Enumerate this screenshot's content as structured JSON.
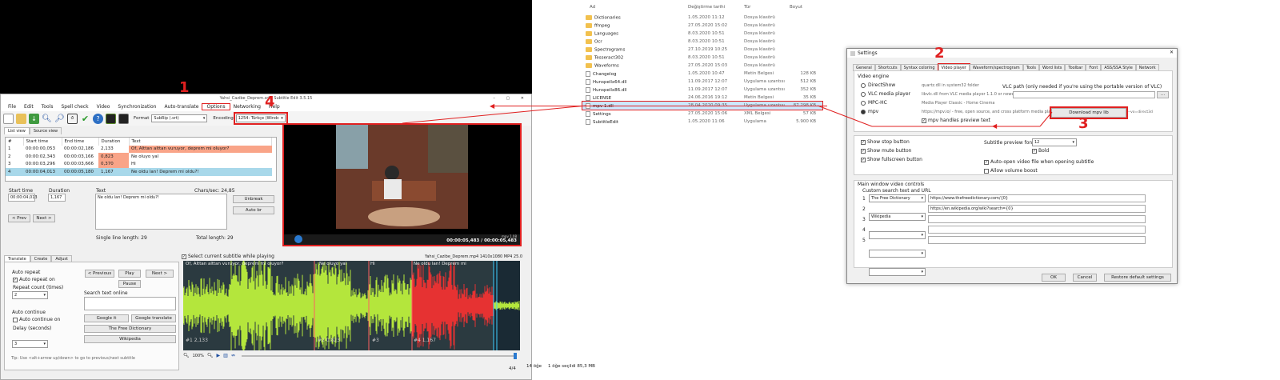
{
  "subtitle_edit": {
    "title": "Yahsi_Cazibe_Deprem.srt - Subtitle Edit 3.5.15",
    "window_controls": "–  ▢  ✕",
    "menu": [
      "File",
      "Edit",
      "Tools",
      "Spell check",
      "Video",
      "Synchronization",
      "Auto-translate",
      "Options",
      "Networking",
      "Help"
    ],
    "format_label": "Format",
    "format_value": "SubRip (.srt)",
    "encoding_label": "Encoding",
    "encoding_value": "1254: Türkçe (Windc",
    "tabs": [
      "List view",
      "Source view"
    ],
    "columns": [
      "#",
      "Start time",
      "End time",
      "Duration",
      "Text"
    ],
    "rows": [
      {
        "n": "1",
        "start": "00:00:00,053",
        "end": "00:00:02,186",
        "dur": "2,133",
        "text": "Of, Alttan alttan vuruyor, deprem mi oluyor?"
      },
      {
        "n": "2",
        "start": "00:00:02,343",
        "end": "00:00:03,166",
        "dur": "0,823",
        "text": "Ne oluyo yal"
      },
      {
        "n": "3",
        "start": "00:00:03,296",
        "end": "00:00:03,666",
        "dur": "0,370",
        "text": "Hi"
      },
      {
        "n": "4",
        "start": "00:00:04,013",
        "end": "00:00:05,180",
        "dur": "1,167",
        "text": "Ne oldu lan! Deprem mi oldu?!"
      }
    ],
    "edit": {
      "start_label": "Start time",
      "dur_label": "Duration",
      "text_label": "Text",
      "chars_sec": "Chars/sec: 24,85",
      "start_val": "00:00:04,013",
      "dur_val": "1,167",
      "text_val": "Ne oldu lan! Deprem mi oldu?!",
      "unbreak": "Unbreak",
      "autobr": "Auto br",
      "prev": "< Prev",
      "next": "Next >",
      "single_len": "Single line length: 29",
      "total_len": "Total length: 29"
    },
    "video": {
      "time": "00:00:05,483 / 00:00:05,483",
      "mpv_label": "mpv 1.08"
    },
    "translate": {
      "tabs": [
        "Translate",
        "Create",
        "Adjust"
      ],
      "auto_repeat": "Auto repeat",
      "auto_repeat_on": "Auto repeat on",
      "repeat_count": "Repeat count (times)",
      "repeat_val": "2",
      "auto_continue": "Auto continue",
      "auto_continue_on": "Auto continue on",
      "delay": "Delay (seconds)",
      "delay_val": "3",
      "previous": "< Previous",
      "play": "Play",
      "next": "Next >",
      "pause": "Pause",
      "search_online": "Search text online",
      "google_it": "Google it",
      "google_translate": "Google translate",
      "free_dict": "The Free Dictionary",
      "wikipedia": "Wikipedia",
      "tip": "Tip: Use <alt+arrow up/down> to go to previous/next subtitle"
    },
    "wave": {
      "select_current": "Select current subtitle while playing",
      "file_info": "Yahsi_Cazibe_Deprem.mp4 1410x1080 MP4 25.0",
      "labels": [
        "Of, Alttan alttan vuruyor, deprem mi oluyor?",
        "Ne oluyo yal",
        "Hi",
        "Ne oldu lan! Deprem mi"
      ],
      "markers": [
        "#1  2,133",
        "#2  0,823",
        "#3",
        "#4  1,167"
      ],
      "zoom": "100%"
    },
    "status": "4/4"
  },
  "explorer": {
    "headers": [
      "Ad",
      "Değiştirme tarihi",
      "Tür",
      "Boyut"
    ],
    "rows": [
      {
        "name": "Dictionaries",
        "date": "1.05.2020 11:12",
        "type": "Dosya klasörü",
        "size": "",
        "kind": "folder"
      },
      {
        "name": "ffmpeg",
        "date": "27.05.2020 15:02",
        "type": "Dosya klasörü",
        "size": "",
        "kind": "folder"
      },
      {
        "name": "Languages",
        "date": "8.03.2020 10:51",
        "type": "Dosya klasörü",
        "size": "",
        "kind": "folder"
      },
      {
        "name": "Ocr",
        "date": "8.03.2020 10:51",
        "type": "Dosya klasörü",
        "size": "",
        "kind": "folder"
      },
      {
        "name": "Spectrograms",
        "date": "27.10.2019 10:25",
        "type": "Dosya klasörü",
        "size": "",
        "kind": "folder"
      },
      {
        "name": "Tesseract302",
        "date": "8.03.2020 10:51",
        "type": "Dosya klasörü",
        "size": "",
        "kind": "folder"
      },
      {
        "name": "Waveforms",
        "date": "27.05.2020 15:03",
        "type": "Dosya klasörü",
        "size": "",
        "kind": "folder"
      },
      {
        "name": "Changelog",
        "date": "1.05.2020 10:47",
        "type": "Metin Belgesi",
        "size": "128 KB",
        "kind": "file"
      },
      {
        "name": "Hunspellx64.dll",
        "date": "11.09.2017 12:07",
        "type": "Uygulama uzantısı",
        "size": "512 KB",
        "kind": "file"
      },
      {
        "name": "Hunspellx86.dll",
        "date": "11.09.2017 12:07",
        "type": "Uygulama uzantısı",
        "size": "352 KB",
        "kind": "file"
      },
      {
        "name": "LICENSE",
        "date": "24.06.2016 19:12",
        "type": "Metin Belgesi",
        "size": "35 KB",
        "kind": "file"
      },
      {
        "name": "mpv-1.dll",
        "date": "28.04.2020 09:35",
        "type": "Uygulama uzantısı",
        "size": "87.298 KB",
        "kind": "file"
      },
      {
        "name": "Settings",
        "date": "27.05.2020 15:06",
        "type": "XML Belgesi",
        "size": "57 KB",
        "kind": "file"
      },
      {
        "name": "SubtitleEdit",
        "date": "1.05.2020 11:06",
        "type": "Uygulama",
        "size": "5.900 KB",
        "kind": "file"
      }
    ],
    "status_items": "14 öğe",
    "status_selected": "1 öğe seçildi 85,3 MB"
  },
  "settings": {
    "title": "Settings",
    "tabs": [
      "General",
      "Shortcuts",
      "Syntax coloring",
      "Video player",
      "Waveform/spectrogram",
      "Tools",
      "Word lists",
      "Toolbar",
      "Font",
      "ASS/SSA Style",
      "Network"
    ],
    "video_engine": "Video engine",
    "engines": [
      {
        "name": "DirectShow",
        "desc": "quartz.dll in system32 folder"
      },
      {
        "name": "VLC media player",
        "desc": "libvlc.dll from VLC media player 1.1.0 or newer"
      },
      {
        "name": "MPC-HC",
        "desc": "Media Player Classic - Home Cinema"
      },
      {
        "name": "mpv",
        "desc": "https://mpv.io/ - free, open source, and cross platform media player"
      }
    ],
    "vlc_path": "VLC path (only needed if you're using the portable version of VLC)",
    "download_mpv": "Download mpv lib",
    "vo_direct": "--vo=direct3d",
    "mpv_handles": "mpv handles preview text",
    "show_stop": "Show stop button",
    "show_mute": "Show mute button",
    "show_fullscreen": "Show fullscreen button",
    "preview_font": "Subtitle preview font size",
    "font_size": "12",
    "bold": "Bold",
    "auto_open": "Auto-open video file when opening subtitle",
    "allow_boost": "Allow volume boost",
    "main_controls": "Main window video controls",
    "custom_search": "Custom search text and URL",
    "search_rows": [
      {
        "n": "1",
        "name": "The Free Dictionary",
        "url": "https://www.thefreedictionary.com/{0}"
      },
      {
        "n": "2",
        "name": "Wikipedia",
        "url": "https://en.wikipedia.org/wiki?search={0}"
      },
      {
        "n": "3",
        "name": "",
        "url": ""
      },
      {
        "n": "4",
        "name": "",
        "url": ""
      },
      {
        "n": "5",
        "name": "",
        "url": ""
      }
    ],
    "ok": "OK",
    "cancel": "Cancel",
    "restore": "Restore default settings"
  },
  "annotations": [
    "1",
    "2",
    "3",
    "4"
  ]
}
